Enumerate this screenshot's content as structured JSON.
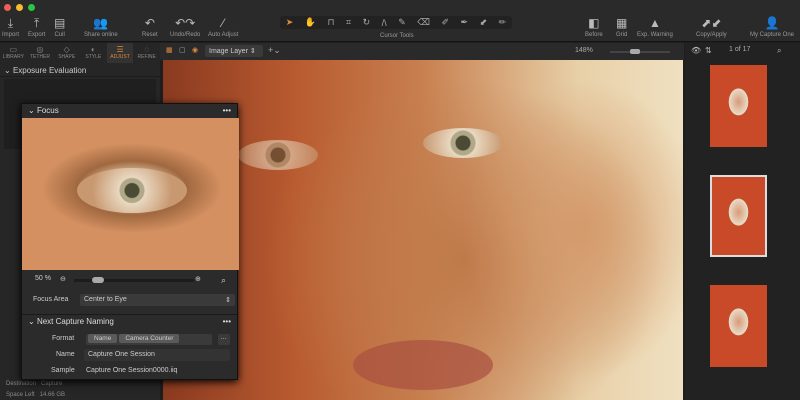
{
  "toolbar": {
    "import": "Import",
    "export": "Export",
    "cull": "Cull",
    "share": "Share online",
    "reset": "Reset",
    "undoredo": "Undo/Redo",
    "auto": "Auto Adjust",
    "cursor_tools": "Cursor Tools",
    "before": "Before",
    "grid": "Grid",
    "exp_warning": "Exp. Warning",
    "copyapply": "Copy/Apply",
    "account": "My Capture One"
  },
  "tabs": [
    "LIBRARY",
    "TETHER",
    "SHAPE",
    "STYLE",
    "ADJUST",
    "REFINE"
  ],
  "left": {
    "exposure": "Exposure Evaluation",
    "destination_label": "Destination",
    "destination_value": "Capture",
    "space_label": "Space Left",
    "space_value": "14.66 GB"
  },
  "viewbar": {
    "layer": "Image Layer",
    "zoom": "148%"
  },
  "film": {
    "counter": "1 of 17"
  },
  "focus": {
    "title": "Focus",
    "zoom": "50 %",
    "area_label": "Focus Area",
    "area_value": "Center to Eye"
  },
  "naming": {
    "title": "Next Capture Naming",
    "format_label": "Format",
    "tokens": [
      "Name",
      "Camera Counter"
    ],
    "name_label": "Name",
    "name_value": "Capture One Session",
    "sample_label": "Sample",
    "sample_value": "Capture One Session0000.iiq"
  }
}
